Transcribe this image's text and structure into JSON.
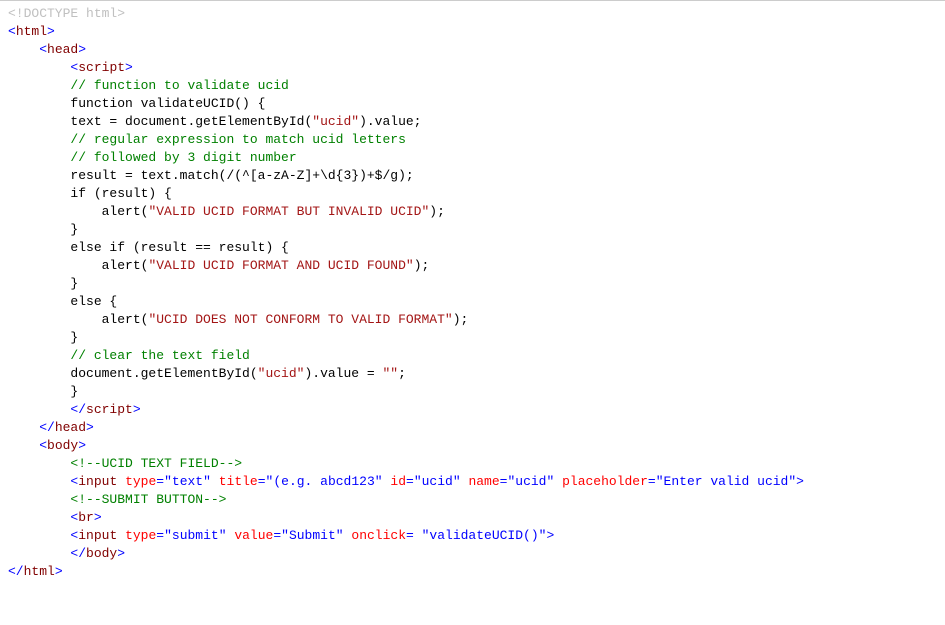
{
  "code": {
    "lines": [
      {
        "indent": 0,
        "type": "doctype",
        "content": "<!DOCTYPE html>"
      },
      {
        "indent": 0,
        "type": "tag-open",
        "tag": "html"
      },
      {
        "indent": 1,
        "type": "tag-open",
        "tag": "head"
      },
      {
        "indent": 2,
        "type": "tag-open",
        "tag": "script"
      },
      {
        "indent": 2,
        "type": "js-comment",
        "content": "// function to validate ucid"
      },
      {
        "indent": 2,
        "type": "js",
        "content": "function validateUCID() {"
      },
      {
        "indent": 2,
        "type": "js-with-string",
        "prefix": "text = document.getElementById(",
        "string": "\"ucid\"",
        "suffix": ").value;"
      },
      {
        "indent": 2,
        "type": "js-comment",
        "content": "// regular expression to match ucid letters"
      },
      {
        "indent": 2,
        "type": "js-comment",
        "content": "// followed by 3 digit number"
      },
      {
        "indent": 2,
        "type": "js",
        "content": "result = text.match(/(^[a-zA-Z]+\\d{3})+$/g);"
      },
      {
        "indent": 2,
        "type": "js",
        "content": "if (result) {"
      },
      {
        "indent": 3,
        "type": "js-with-string",
        "prefix": "alert(",
        "string": "\"VALID UCID FORMAT BUT INVALID UCID\"",
        "suffix": ");"
      },
      {
        "indent": 2,
        "type": "js",
        "content": "}"
      },
      {
        "indent": 2,
        "type": "js",
        "content": "else if (result == result) {"
      },
      {
        "indent": 3,
        "type": "js-with-string",
        "prefix": "alert(",
        "string": "\"VALID UCID FORMAT AND UCID FOUND\"",
        "suffix": ");"
      },
      {
        "indent": 2,
        "type": "js",
        "content": "}"
      },
      {
        "indent": 2,
        "type": "js",
        "content": "else {"
      },
      {
        "indent": 3,
        "type": "js-with-string",
        "prefix": "alert(",
        "string": "\"UCID DOES NOT CONFORM TO VALID FORMAT\"",
        "suffix": ");"
      },
      {
        "indent": 2,
        "type": "js",
        "content": "}"
      },
      {
        "indent": 2,
        "type": "js-comment",
        "content": "// clear the text field"
      },
      {
        "indent": 2,
        "type": "js-with-string",
        "prefix": "document.getElementById(",
        "string": "\"ucid\"",
        "suffix": ").value = \"\";"
      },
      {
        "indent": 2,
        "type": "js",
        "content": "}"
      },
      {
        "indent": 2,
        "type": "tag-close",
        "tag": "script"
      },
      {
        "indent": 1,
        "type": "tag-close",
        "tag": "head"
      },
      {
        "indent": 1,
        "type": "tag-open",
        "tag": "body"
      },
      {
        "indent": 2,
        "type": "comment",
        "content": "<!--UCID TEXT FIELD-->"
      },
      {
        "indent": 2,
        "type": "tag-with-attrs",
        "tag": "input",
        "attrs": [
          [
            "type",
            "\"text\""
          ],
          [
            "title",
            "\"(e.g. abcd123\""
          ],
          [
            "id",
            "\"ucid\""
          ],
          [
            "name",
            "\"ucid\""
          ],
          [
            "placeholder",
            "\"Enter valid ucid\""
          ]
        ]
      },
      {
        "indent": 2,
        "type": "comment",
        "content": "<!--SUBMIT BUTTON-->"
      },
      {
        "indent": 2,
        "type": "tag-open",
        "tag": "br"
      },
      {
        "indent": 2,
        "type": "tag-with-attrs",
        "tag": "input",
        "attrs": [
          [
            "type",
            "\"submit\""
          ],
          [
            "value",
            "\"Submit\""
          ],
          [
            "onclick",
            " \"validateUCID()\""
          ]
        ]
      },
      {
        "indent": 2,
        "type": "tag-close",
        "tag": "body"
      },
      {
        "indent": 0,
        "type": "tag-close",
        "tag": "html"
      }
    ]
  }
}
